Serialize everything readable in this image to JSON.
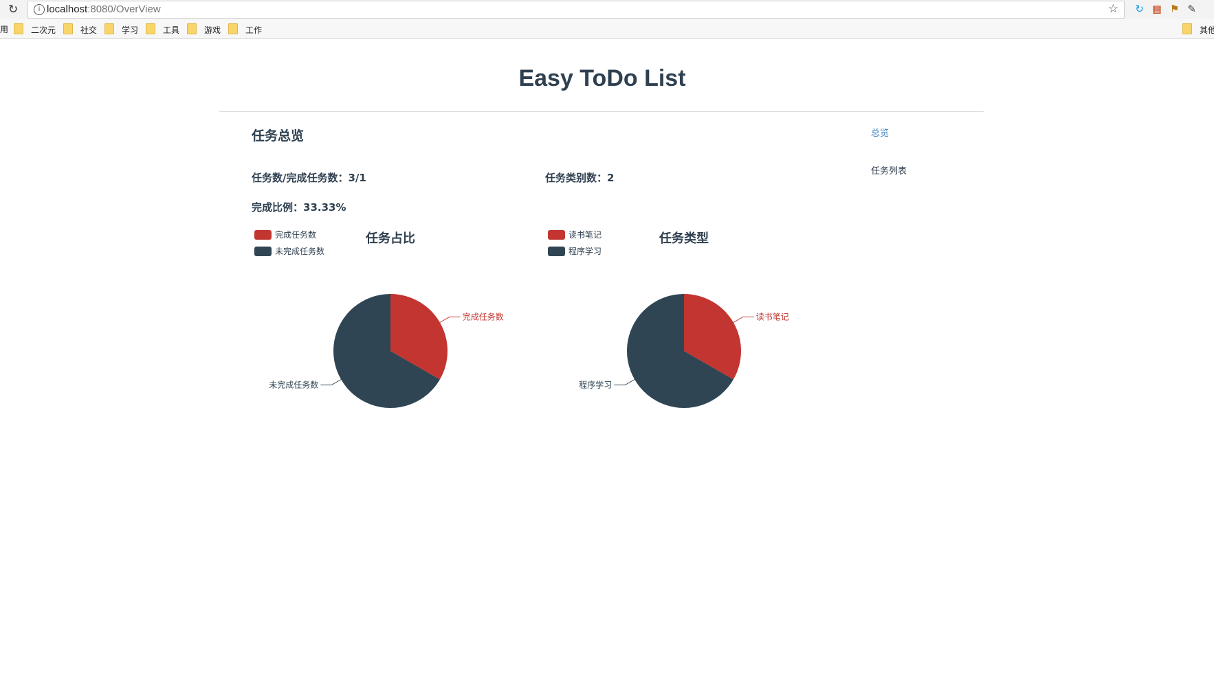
{
  "browser": {
    "url_host": "localhost",
    "url_path": ":8080/OverView"
  },
  "bookmarks": {
    "left_edge": "用",
    "items": [
      "二次元",
      "社交",
      "学习",
      "工具",
      "游戏",
      "工作"
    ],
    "other": "其他"
  },
  "page": {
    "site_title": "Easy ToDo List",
    "section_title": "任务总览",
    "nav": {
      "overview": "总览",
      "task_list": "任务列表"
    },
    "stats": {
      "task_count_label": "任务数/完成任务数：",
      "task_count_value": "3/1",
      "category_count_label": "任务类别数：",
      "category_count_value": "2",
      "completion_label": "完成比例：",
      "completion_value": "33.33%"
    }
  },
  "colors": {
    "red": "#c23531",
    "dark": "#2f4554"
  },
  "chart_data": [
    {
      "type": "pie",
      "title": "任务占比",
      "legend": [
        "完成任务数",
        "未完成任务数"
      ],
      "legend_position": "top-left",
      "series": [
        {
          "name": "完成任务数",
          "value": 1
        },
        {
          "name": "未完成任务数",
          "value": 2
        }
      ]
    },
    {
      "type": "pie",
      "title": "任务类型",
      "legend": [
        "读书笔记",
        "程序学习"
      ],
      "legend_position": "top-left",
      "series": [
        {
          "name": "读书笔记",
          "value": 1
        },
        {
          "name": "程序学习",
          "value": 2
        }
      ]
    }
  ]
}
